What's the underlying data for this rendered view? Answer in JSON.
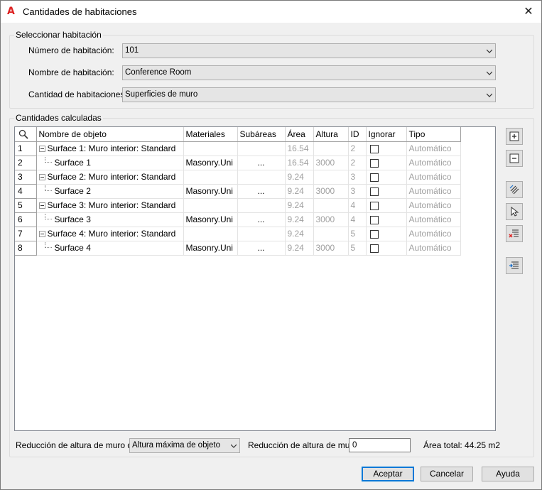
{
  "window": {
    "title": "Cantidades de habitaciones"
  },
  "select_group": {
    "legend": "Seleccionar habitación",
    "room_number_label": "Número de habitación:",
    "room_number_value": "101",
    "room_name_label": "Nombre de habitación:",
    "room_name_value": "Conference Room",
    "quantity_label": "Cantidad de habitaciones:",
    "quantity_value": "Superficies de muro"
  },
  "calc_group": {
    "legend": "Cantidades calculadas",
    "columns": [
      "Nombre de objeto",
      "Materiales",
      "Subáreas",
      "Área",
      "Altura",
      "ID",
      "Ignorar",
      "Tipo"
    ],
    "rows": [
      {
        "n": "1",
        "name": "Surface 1: Muro interior: Standard",
        "child": false,
        "material": "",
        "sub": "",
        "area": "16.54",
        "height": "",
        "id": "2",
        "type": "Automático"
      },
      {
        "n": "2",
        "name": "Surface 1",
        "child": true,
        "material": "Masonry.Uni",
        "sub": "...",
        "area": "16.54",
        "height": "3000",
        "id": "2",
        "type": "Automático"
      },
      {
        "n": "3",
        "name": "Surface 2: Muro interior: Standard",
        "child": false,
        "material": "",
        "sub": "",
        "area": "9.24",
        "height": "",
        "id": "3",
        "type": "Automático"
      },
      {
        "n": "4",
        "name": "Surface 2",
        "child": true,
        "material": "Masonry.Uni",
        "sub": "...",
        "area": "9.24",
        "height": "3000",
        "id": "3",
        "type": "Automático"
      },
      {
        "n": "5",
        "name": "Surface 3: Muro interior: Standard",
        "child": false,
        "material": "",
        "sub": "",
        "area": "9.24",
        "height": "",
        "id": "4",
        "type": "Automático"
      },
      {
        "n": "6",
        "name": "Surface 3",
        "child": true,
        "material": "Masonry.Uni",
        "sub": "...",
        "area": "9.24",
        "height": "3000",
        "id": "4",
        "type": "Automático"
      },
      {
        "n": "7",
        "name": "Surface 4: Muro interior: Standard",
        "child": false,
        "material": "",
        "sub": "",
        "area": "9.24",
        "height": "",
        "id": "5",
        "type": "Automático"
      },
      {
        "n": "8",
        "name": "Surface 4",
        "child": true,
        "material": "Masonry.Uni",
        "sub": "...",
        "area": "9.24",
        "height": "3000",
        "id": "5",
        "type": "Automático"
      }
    ]
  },
  "side_icons": [
    "add-row-icon",
    "remove-row-icon",
    "select-objects-icon",
    "pick-cursor-icon",
    "delete-list-icon",
    "import-list-icon"
  ],
  "bottom": {
    "reduction_label": "Reducción de altura de muro de",
    "reduction_select": "Altura máxima de objeto",
    "reduction_value_label": "Reducción de altura de muro",
    "reduction_value": "0",
    "total_area": "Área total: 44.25 m2"
  },
  "buttons": {
    "ok": "Aceptar",
    "cancel": "Cancelar",
    "help": "Ayuda"
  }
}
